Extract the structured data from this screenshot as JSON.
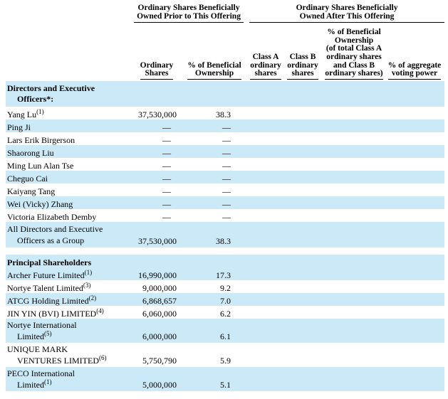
{
  "header": {
    "prior_group": "Ordinary Shares Beneficially Owned Prior to This Offering",
    "prior_group_line1": "Ordinary Shares Beneficially",
    "prior_group_line2": "Owned Prior to This Offering",
    "after_group_line1": "Ordinary Shares Beneficially",
    "after_group_line2": "Owned After This Offering",
    "col_ordinary_l1": "Ordinary",
    "col_ordinary_l2": "Shares",
    "col_pct_l1": "% of Beneficial",
    "col_pct_l2": "Ownership",
    "col_classA_l1": "Class A",
    "col_classA_l2": "ordinary",
    "col_classA_l3": "shares",
    "col_classB_l1": "Class B",
    "col_classB_l2": "ordinary",
    "col_classB_l3": "shares",
    "col_total_l1": "% of Beneficial",
    "col_total_l2": "Ownership",
    "col_total_l3": "(of total Class A",
    "col_total_l4": "ordinary shares",
    "col_total_l5": "and Class B",
    "col_total_l6": "ordinary shares)",
    "col_voting_l1": "% of aggregate",
    "col_voting_l2": "voting power"
  },
  "sections": {
    "directors_l1": "Directors and Executive",
    "directors_l2": "Officers*:",
    "principal": "Principal Shareholders"
  },
  "rows": [
    {
      "name": "Yang Lu",
      "sup": "(1)",
      "ordinary": "37,530,000",
      "pct": "38.3"
    },
    {
      "name": "Ping Ji",
      "sup": "",
      "ordinary": "—",
      "pct": "—"
    },
    {
      "name": "Lars Erik Birgerson",
      "sup": "",
      "ordinary": "—",
      "pct": "—"
    },
    {
      "name": "Shaorong Liu",
      "sup": "",
      "ordinary": "—",
      "pct": "—"
    },
    {
      "name": "Ming Lun Alan Tse",
      "sup": "",
      "ordinary": "—",
      "pct": "—"
    },
    {
      "name": "Cheguo Cai",
      "sup": "",
      "ordinary": "—",
      "pct": "—"
    },
    {
      "name": "Kaiyang Tang",
      "sup": "",
      "ordinary": "—",
      "pct": "—"
    },
    {
      "name": "Wei (Vicky) Zhang",
      "sup": "",
      "ordinary": "—",
      "pct": "—"
    },
    {
      "name": "Victoria Elizabeth Demby",
      "sup": "",
      "ordinary": "—",
      "pct": "—"
    }
  ],
  "group_total": {
    "name_l1": "All Directors and Executive",
    "name_l2": "Officers as a Group",
    "ordinary": "37,530,000",
    "pct": "38.3"
  },
  "principal_rows": [
    {
      "name_l1": "Archer Future Limited",
      "name_l2": "",
      "sup": "(1)",
      "ordinary": "16,990,000",
      "pct": "17.3"
    },
    {
      "name_l1": "Nortye Talent Limited",
      "name_l2": "",
      "sup": "(3)",
      "ordinary": "9,000,000",
      "pct": "9.2"
    },
    {
      "name_l1": "ATCG Holding Limited",
      "name_l2": "",
      "sup": "(2)",
      "ordinary": "6,868,657",
      "pct": "7.0"
    },
    {
      "name_l1": "JIN YIN (BVI) LIMITED",
      "name_l2": "",
      "sup": "(4)",
      "ordinary": "6,060,000",
      "pct": "6.2"
    },
    {
      "name_l1": "Nortye International",
      "name_l2": "Limited",
      "sup": "(5)",
      "ordinary": "6,000,000",
      "pct": "6.1"
    },
    {
      "name_l1": "UNIQUE MARK",
      "name_l2": "VENTURES LIMITED",
      "sup": "(6)",
      "ordinary": "5,750,790",
      "pct": "5.9"
    },
    {
      "name_l1": "PECO International",
      "name_l2": "Limited",
      "sup": "(1)",
      "ordinary": "5,000,000",
      "pct": "5.1"
    }
  ],
  "colors": {
    "shade": "#cce9f7"
  }
}
